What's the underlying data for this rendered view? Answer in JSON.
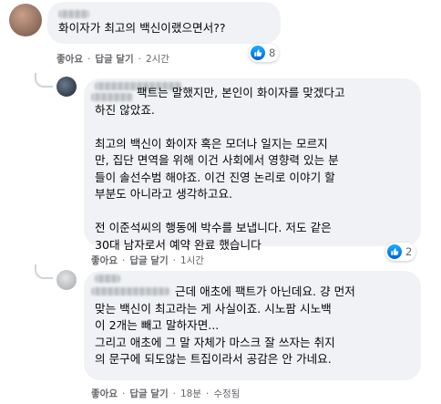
{
  "comments": [
    {
      "text": "화이자가 최고의 백신이랬으면서??",
      "reactions": "8",
      "actions": {
        "like": "좋아요",
        "reply": "답글 달기",
        "time": "2시간"
      }
    },
    {
      "text": "팩트는 말했지만, 본인이 화이자를 맞겠다고\n하진 않았죠.\n\n최고의 백신이 화이자 혹은 모더나 일지는 모르지\n만, 집단 면역을 위해 이건 사회에서 영향력 있는 분\n들이 솔선수범 해야죠. 이건 진영 논리로 이야기 할\n부분도 아니라고 생각하고요.\n\n전 이준석씨의 행동에 박수를 보냅니다. 저도 같은\n30대 남자로서 예약 완료 했습니다",
      "reactions": "2",
      "actions": {
        "like": "좋아요",
        "reply": "답글 달기",
        "time": "1시간"
      }
    },
    {
      "text": "근데 애초에 팩트가 아닌데요. 걍 먼저\n맞는 백신이 최고라는 게 사실이죠. 시노팜 시노백\n이 2개는 빼고 말하자면...\n그리고 애초에 그 말 자체가 마스크 잘 쓰자는 취지\n의 문구에 되도않는 트집이라서 공감은 안 가네요.",
      "actions": {
        "like": "좋아요",
        "reply": "답글 달기",
        "time": "18분",
        "edited": "수정됨"
      }
    }
  ],
  "colors": {
    "bubble": "#f0f2f5",
    "like_blue": "#1877f2",
    "meta_text": "#65676b"
  },
  "icons": {
    "reaction": "thumbs-up-icon"
  }
}
